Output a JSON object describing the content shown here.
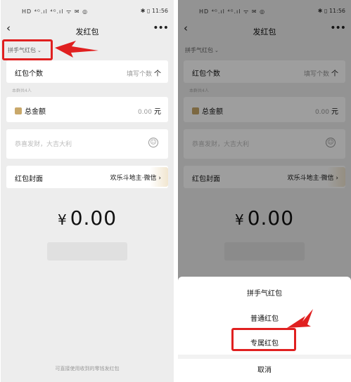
{
  "status": {
    "left_icons": "HD ⁴ᴳ.ıl ⁴ᴳ.ıl ᯤ ✉ ◎",
    "right_icons": "✱ ▯ 11:56"
  },
  "nav": {
    "title": "发红包",
    "back": "‹",
    "more": "•••"
  },
  "packet_type": {
    "label": "拼手气红包",
    "chevron": "⌄"
  },
  "count_row": {
    "label": "红包个数",
    "placeholder": "填写个数",
    "unit": "个"
  },
  "hint": "本群共4人",
  "amount_row": {
    "label": "总金额",
    "value": "0.00",
    "unit": "元"
  },
  "greeting": {
    "placeholder": "恭喜发财，大吉大利",
    "emoji_icon": "☺"
  },
  "cover_row": {
    "label": "红包封面",
    "value": "欢乐斗地主·微信",
    "chevron": "›"
  },
  "total": {
    "currency": "¥",
    "value": "0.00"
  },
  "footer_note": "可直接使用收到的零钱发红包",
  "sheet": {
    "options": [
      "拼手气红包",
      "普通红包",
      "专属红包"
    ],
    "cancel": "取消"
  },
  "colors": {
    "highlight": "#e02020",
    "background": "#ededed",
    "overlay": "rgba(0,0,0,0.38)"
  }
}
